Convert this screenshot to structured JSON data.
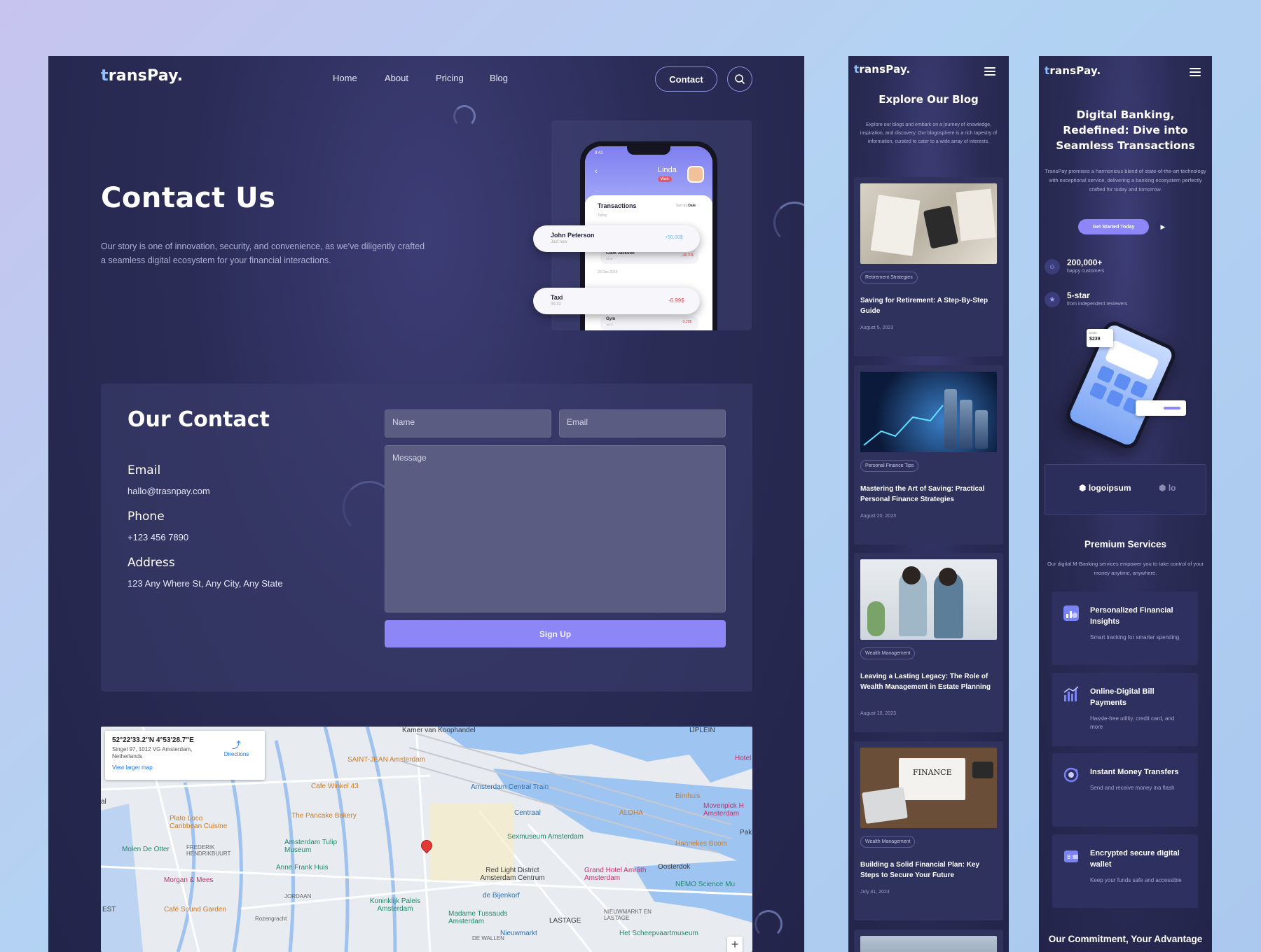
{
  "desktop": {
    "logo_first": "t",
    "logo_rest": "ransPay.",
    "nav": [
      "Home",
      "About",
      "Pricing",
      "Blog"
    ],
    "contact_button": "Contact",
    "search_icon": "search-icon",
    "hero_title": "Contact Us",
    "hero_text": "Our story is one of innovation, security, and convenience, as we've diligently crafted a seamless digital ecosystem for your financial interactions.",
    "phone": {
      "time": "9:41",
      "user": "Linda",
      "badge": "Work",
      "transactions_title": "Transactions",
      "sort_label": "Sort by",
      "sort_value": "Date",
      "today": "Today",
      "date2": "20 Dec 2019",
      "items": [
        {
          "name": "John Peterson",
          "sub": "Just now",
          "amount": "+50,00$"
        },
        {
          "name": "Clark Jackson",
          "sub": "09:32",
          "amount": "-46.70$"
        },
        {
          "name": "Taxi",
          "sub": "09:32",
          "amount": "-6.99$"
        },
        {
          "name": "Gym",
          "sub": "18:07",
          "amount": "-3.29$"
        }
      ]
    },
    "contact_heading": "Our Contact",
    "email_label": "Email",
    "email_value": "hallo@trasnpay.com",
    "phone_label": "Phone",
    "phone_value": "+123 456 7890",
    "address_label": "Address",
    "address_value": "123 Any Where St, Any City, Any State",
    "form": {
      "name_placeholder": "Name",
      "email_placeholder": "Email",
      "message_placeholder": "Message",
      "submit": "Sign Up"
    },
    "map": {
      "coords": "52°22'33.2\"N 4°53'28.7\"E",
      "address": "Singel 97, 1012 VG Amsterdam, Netherlands",
      "directions": "Directions",
      "larger_map": "View larger map",
      "labels": [
        {
          "t": "Kamer van Koophandel",
          "c": ""
        },
        {
          "t": "IJPLEIN",
          "c": ""
        },
        {
          "t": "SAINT-JEAN Amsterdam",
          "c": "o"
        },
        {
          "t": "Cafe Winkel 43",
          "c": "o"
        },
        {
          "t": "Amsterdam Central Train",
          "c": "b"
        },
        {
          "t": "Centraal",
          "c": "b"
        },
        {
          "t": "Bimhuis",
          "c": "o"
        },
        {
          "t": "Movenpick H Amsterdam",
          "c": "p"
        },
        {
          "t": "Plato Loco Caribbean Cuisine",
          "c": "o"
        },
        {
          "t": "The Pancake Bakery",
          "c": "o"
        },
        {
          "t": "ALOHA",
          "c": "o"
        },
        {
          "t": "Molen De Otter",
          "c": "g"
        },
        {
          "t": "FREDERIK HENDRIKBUURT",
          "c": ""
        },
        {
          "t": "Amsterdam Tulip Museum",
          "c": "g"
        },
        {
          "t": "Sexmuseum Amsterdam",
          "c": "g"
        },
        {
          "t": "Hannekes Boom",
          "c": "o"
        },
        {
          "t": "Anne Frank Huis",
          "c": "g"
        },
        {
          "t": "Red Light District Amsterdam Centrum",
          "c": ""
        },
        {
          "t": "Grand Hotel Amrâth Amsterdam",
          "c": "p"
        },
        {
          "t": "Oosterdok",
          "c": ""
        },
        {
          "t": "Morgan & Mees",
          "c": "p"
        },
        {
          "t": "JORDAAN",
          "c": ""
        },
        {
          "t": "de Bijenkorf",
          "c": "b"
        },
        {
          "t": "NEMO Science Mu",
          "c": "g"
        },
        {
          "t": "Café Sound Garden",
          "c": "o"
        },
        {
          "t": "Koninklijk Paleis Amsterdam",
          "c": "g"
        },
        {
          "t": "Madame Tussauds Amsterdam",
          "c": "g"
        },
        {
          "t": "LASTAGE",
          "c": ""
        },
        {
          "t": "NIEUWMARKT EN LASTAGE",
          "c": ""
        },
        {
          "t": "Nieuwmarkt",
          "c": "b"
        },
        {
          "t": "DE WALLEN",
          "c": ""
        },
        {
          "t": "Het Scheepvaartmuseum",
          "c": "g"
        },
        {
          "t": "EST",
          "c": ""
        },
        {
          "t": "Rozengracht",
          "c": ""
        },
        {
          "t": "Hotel",
          "c": "p"
        },
        {
          "t": "Pakh",
          "c": ""
        },
        {
          "t": "al",
          "c": ""
        }
      ],
      "zoom_in": "+"
    }
  },
  "blog": {
    "logo_first": "t",
    "logo_rest": "ransPay.",
    "title": "Explore Our Blog",
    "intro": "Explore our blogs and embark on a journey of knowledge, inspiration, and discovery. Our blogosphere is a rich tapestry of information, curated to cater to a wide array of interests.",
    "posts": [
      {
        "tag": "Retirement Strategies",
        "title": "Saving for Retirement: A Step-By-Step Guide",
        "date": "August 5, 2023"
      },
      {
        "tag": "Personal Finance Tips",
        "title": "Mastering the Art of Saving: Practical Personal Finance Strategies",
        "date": "August 20, 2023"
      },
      {
        "tag": "Wealth Management",
        "title": "Leaving a Lasting Legacy: The Role of Wealth Management in Estate Planning",
        "date": "August 10, 2023"
      },
      {
        "tag": "Wealth Management",
        "title": "Building a Solid Financial Plan: Key Steps to Secure Your Future",
        "date": "July 31, 2023"
      }
    ],
    "finance_word": "FINANCE"
  },
  "bank": {
    "logo_first": "t",
    "logo_rest": "ransPay.",
    "title": "Digital Banking, Redefined: Dive into Seamless Transactions",
    "intro": "TransPay promises a harmonious blend of state-of-the-art technology with exceptional service, delivering a banking ecosystem perfectly crafted for today and tomorrow.",
    "cta": "Get Started Today",
    "stat1_value": "200,000+",
    "stat1_label": "happy customers",
    "stat2_value": "5-star",
    "stat2_label": "from independent reviewers",
    "phone_price": "$239",
    "phone_small": "Debit",
    "logo_partner": "logoipsum",
    "logo_partner2": "lo",
    "services_title": "Premium Services",
    "services_intro": "Our digital M-Banking services empower you to take control of your money anytime, anywhere.",
    "services": [
      {
        "title": "Personalized Financial Insights",
        "desc": "Smart tracking for smarter spending"
      },
      {
        "title": "Online-Digital Bill Payments",
        "desc": "Hassle-free utility, credit card, and more"
      },
      {
        "title": "Instant Money Transfers",
        "desc": "Send and receive money ina flash"
      },
      {
        "title": "Encrypted secure digital wallet",
        "desc": "Keep your funds safe and accessible"
      }
    ],
    "commitment": "Our Commitment, Your Advantage"
  },
  "colors": {
    "accent": "#8d86f6",
    "panel": "#2a2c56",
    "logo_t": "#8fc0ff"
  }
}
